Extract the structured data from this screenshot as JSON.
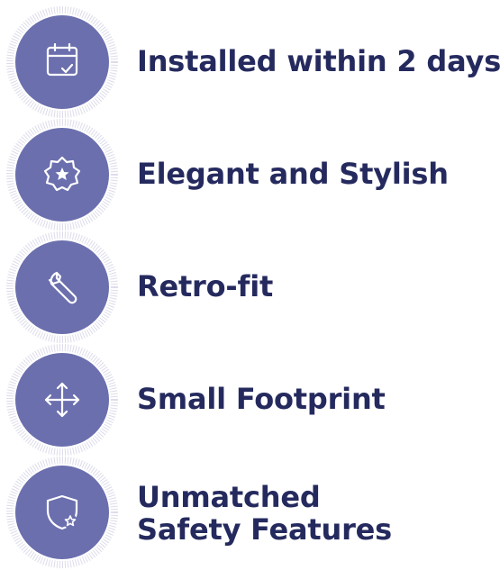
{
  "colors": {
    "badge_fill": "#6b6fae",
    "badge_ring": "#dcdcea",
    "icon_stroke": "#ffffff",
    "text": "#252a5e"
  },
  "features": [
    {
      "icon": "calendar-check-icon",
      "label": "Installed within 2 days"
    },
    {
      "icon": "star-badge-icon",
      "label": "Elegant and Stylish"
    },
    {
      "icon": "wrench-icon",
      "label": "Retro-fit"
    },
    {
      "icon": "move-arrows-icon",
      "label": "Small Footprint"
    },
    {
      "icon": "shield-star-icon",
      "label_line1": "Unmatched",
      "label_line2": "Safety Features"
    }
  ]
}
